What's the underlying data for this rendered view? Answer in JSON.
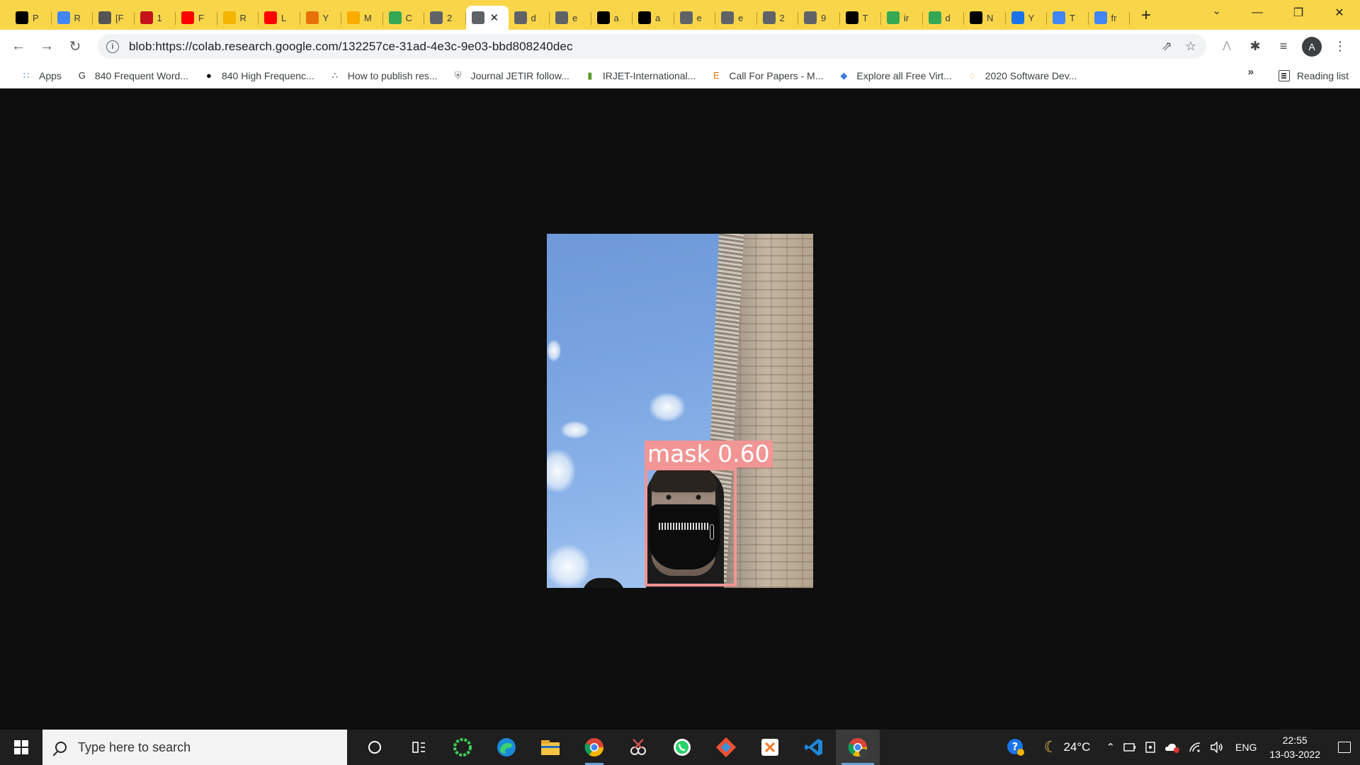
{
  "browser": {
    "tabs": [
      {
        "icon": "notion-icon",
        "label": "P",
        "color": "#000000"
      },
      {
        "icon": "docs-icon",
        "label": "R",
        "color": "#4285f4"
      },
      {
        "icon": "arxiv-icon",
        "label": "[F",
        "color": "#555555"
      },
      {
        "icon": "pdf-icon",
        "label": "1",
        "color": "#c4131a"
      },
      {
        "icon": "youtube-icon",
        "label": "F",
        "color": "#ff0000"
      },
      {
        "icon": "slides-icon",
        "label": "R",
        "color": "#f4b400"
      },
      {
        "icon": "youtube-icon",
        "label": "L",
        "color": "#ff0000"
      },
      {
        "icon": "colab-icon",
        "label": "Y",
        "color": "#e8710a"
      },
      {
        "icon": "colab-icon",
        "label": "M",
        "color": "#f9ab00"
      },
      {
        "icon": "drive-icon",
        "label": "C",
        "color": "#34a853"
      },
      {
        "icon": "globe-icon",
        "label": "2",
        "color": "#5f6368"
      },
      {
        "icon": "globe-icon",
        "label": "",
        "color": "#5f6368",
        "active": true
      },
      {
        "icon": "globe-icon",
        "label": "d",
        "color": "#5f6368"
      },
      {
        "icon": "globe-icon",
        "label": "e",
        "color": "#5f6368"
      },
      {
        "icon": "github-icon",
        "label": "a",
        "color": "#000000"
      },
      {
        "icon": "github-icon",
        "label": "a",
        "color": "#000000"
      },
      {
        "icon": "globe-icon",
        "label": "e",
        "color": "#5f6368"
      },
      {
        "icon": "globe-icon",
        "label": "e",
        "color": "#5f6368"
      },
      {
        "icon": "globe-icon",
        "label": "2",
        "color": "#5f6368"
      },
      {
        "icon": "globe-icon",
        "label": "9",
        "color": "#5f6368"
      },
      {
        "icon": "github-icon",
        "label": "T",
        "color": "#000000"
      },
      {
        "icon": "drive-icon",
        "label": "ir",
        "color": "#34a853"
      },
      {
        "icon": "drive-icon",
        "label": "d",
        "color": "#34a853"
      },
      {
        "icon": "monitor-icon",
        "label": "N",
        "color": "#000000"
      },
      {
        "icon": "k-icon",
        "label": "Y",
        "color": "#1a73e8"
      },
      {
        "icon": "google-icon",
        "label": "T",
        "color": "#4285f4"
      },
      {
        "icon": "google-icon",
        "label": "fr",
        "color": "#4285f4"
      }
    ],
    "url": "blob:https://colab.research.google.com/132257ce-31ad-4e3c-9e03-bbd808240dec",
    "profile_initial": "A",
    "bookmarks": [
      {
        "icon": "apps-icon",
        "label": "Apps"
      },
      {
        "icon": "g-icon",
        "label": "840 Frequent Word..."
      },
      {
        "icon": "globe-icon",
        "label": "840 High Frequenc..."
      },
      {
        "icon": "molecule-icon",
        "label": "How to publish res..."
      },
      {
        "icon": "shield-icon",
        "label": "Journal JETIR follow..."
      },
      {
        "icon": "irjet-icon",
        "label": "IRJET-International..."
      },
      {
        "icon": "e-icon",
        "label": "Call For Papers - M..."
      },
      {
        "icon": "diamond-icon",
        "label": "Explore all Free Virt..."
      },
      {
        "icon": "wave-icon",
        "label": "2020 Software Dev..."
      }
    ],
    "bookmarks_more": "»",
    "reading_list": "Reading list"
  },
  "detection": {
    "label": "mask  0.60",
    "box_color": "#f29595"
  },
  "taskbar": {
    "search_placeholder": "Type here to search",
    "temperature": "24°C",
    "language": "ENG",
    "time": "22:55",
    "date": "13-03-2022"
  }
}
